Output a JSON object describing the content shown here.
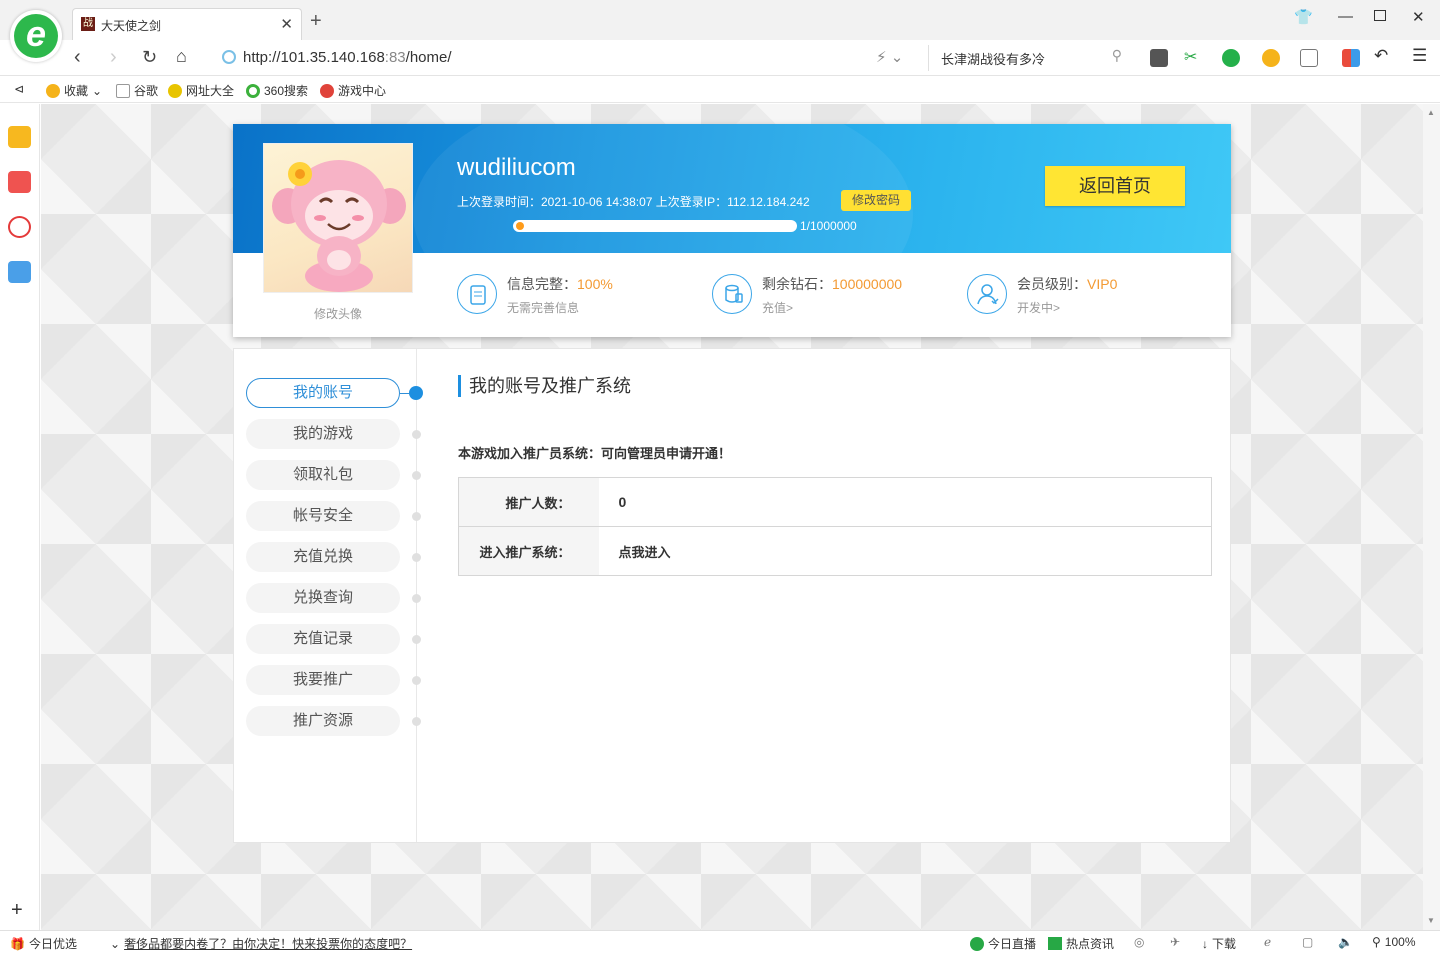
{
  "browser": {
    "tab_title": "大天使之剑",
    "tab_favicon": "战",
    "url_host": "http://101.35.140.168",
    "url_port": ":83",
    "url_path": "/home/",
    "search_text": "长津湖战役有多冷",
    "bookmarks": {
      "favorites": "收藏",
      "google": "谷歌",
      "url_all": "网址大全",
      "search360": "360搜索",
      "game_center": "游戏中心"
    },
    "status": {
      "today_picks": "今日优选",
      "news_link": "奢侈品都要内卷了？由你决定！快来投票你的态度吧？",
      "live": "今日直播",
      "hot_news": "热点资讯",
      "download": "下载",
      "zoom": "100%"
    }
  },
  "profile": {
    "username": "wudiliucom",
    "login_info": "上次登录时间：2021-10-06 14:38:07 上次登录IP：112.12.184.242",
    "change_password": "修改密码",
    "progress_fraction": 1e-06,
    "progress_text": "1/1000000",
    "home_button": "返回首页",
    "avatar_change": "修改头像",
    "stats": [
      {
        "label": "信息完整：",
        "value": "100%",
        "sub": "无需完善信息",
        "icon": "document-icon"
      },
      {
        "label": "剩余钻石：",
        "value": "100000000",
        "sub": "充值>",
        "icon": "diamond-stack-icon"
      },
      {
        "label": "会员级别：",
        "value": "VIP0",
        "sub": "开发中>",
        "icon": "member-icon"
      }
    ]
  },
  "menu": {
    "items": [
      "我的账号",
      "我的游戏",
      "领取礼包",
      "帐号安全",
      "充值兑换",
      "兑换查询",
      "充值记录",
      "我要推广",
      "推广资源"
    ],
    "active_index": 0
  },
  "content": {
    "title": "我的账号及推广系统",
    "notice": "本游戏加入推广员系统：可向管理员申请开通！",
    "rows": [
      {
        "label": "推广人数：",
        "value": "0"
      },
      {
        "label": "进入推广系统：",
        "value": "点我进入"
      }
    ]
  },
  "colors": {
    "accent": "#1d8fe0",
    "highlight": "#f39a33",
    "button_yellow": "#ffe533"
  }
}
